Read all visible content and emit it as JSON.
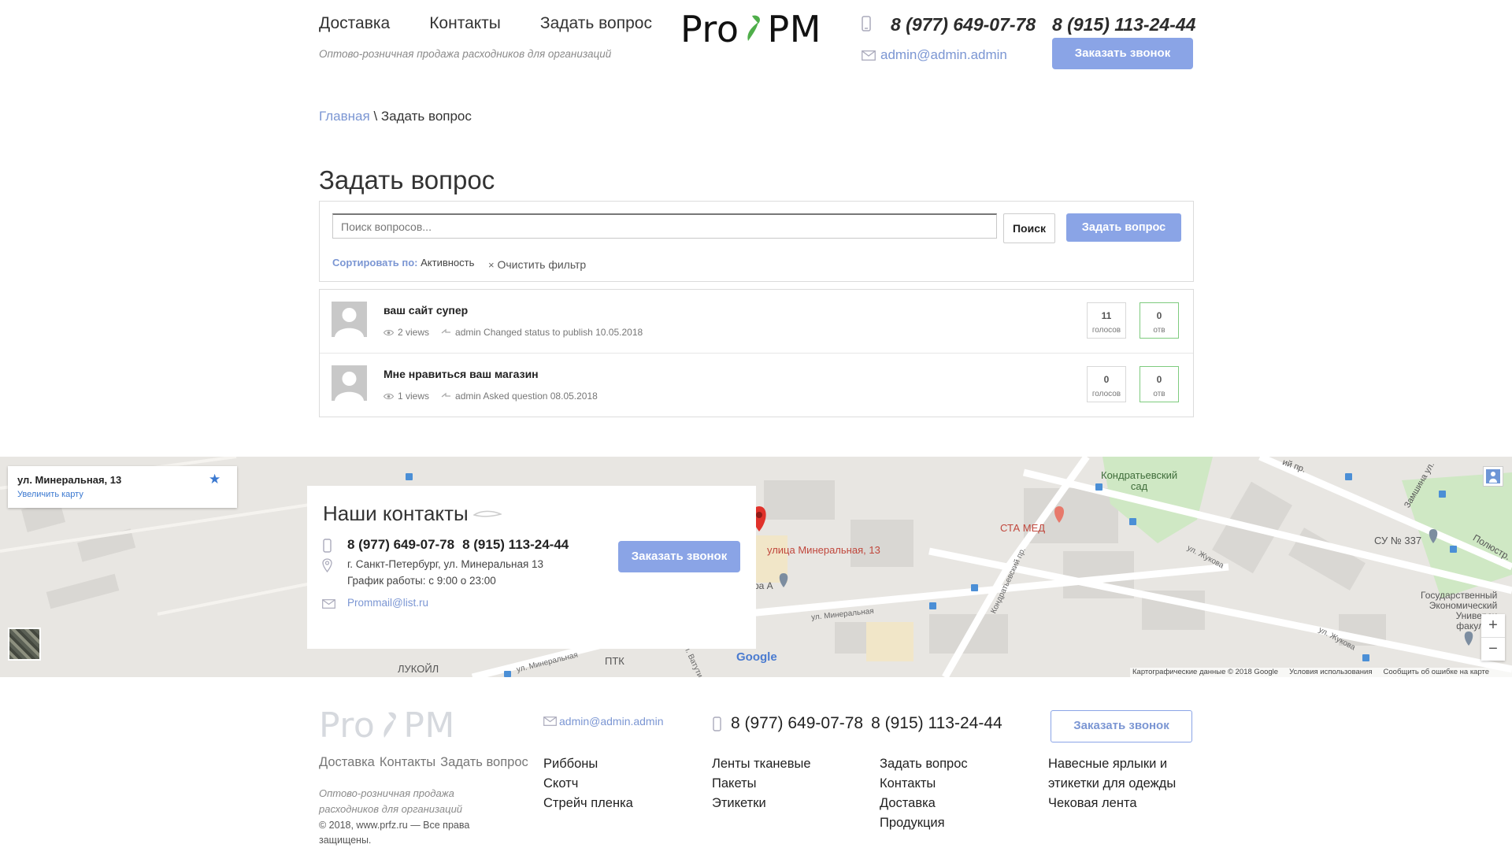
{
  "header": {
    "nav": [
      "Доставка",
      "Контакты",
      "Задать вопрос"
    ],
    "tagline": "Оптово-розничная продажа расходников для организаций",
    "logo_left": "Pro",
    "logo_right": "PM",
    "phone1": "8 (977) 649-07-78",
    "phone2": "8 (915) 113-24-44",
    "email": "admin@admin.admin",
    "call_button": "Заказать звонок"
  },
  "breadcrumb": {
    "home": "Главная",
    "sep": " \\ ",
    "current": "Задать вопрос"
  },
  "page_title": "Задать вопрос",
  "search": {
    "placeholder": "Поиск вопросов...",
    "search_button": "Поиск",
    "ask_button": "Задать вопрос",
    "sort_label": "Сортировать по:",
    "sort_value": "Активность",
    "clear_icon": "×",
    "clear_label": "Очистить фильтр"
  },
  "questions": [
    {
      "title": "ваш сайт супер",
      "views": "2 views",
      "meta": "admin Changed status to publish 10.05.2018",
      "votes": "11",
      "votes_label": "голосов",
      "answers": "0",
      "answers_label": "отв"
    },
    {
      "title": "Мне нравиться ваш магазин",
      "views": "1 views",
      "meta": "admin Asked question 08.05.2018",
      "votes": "0",
      "votes_label": "голосов",
      "answers": "0",
      "answers_label": "отв"
    }
  ],
  "map": {
    "place_title": "ул. Минеральная, 13",
    "enlarge_link": "Увеличить карту",
    "labels": {
      "garden": "Кондратьевский\nсад",
      "sta_med": "СТА МЕД",
      "pin": "улица Минеральная, 13",
      "su": "СУ № 337",
      "street_mineral": "ул. Минеральная",
      "street_mineral2": "ул. Минеральная",
      "street_zhukova": "ул. Жукова",
      "street_zhukova2": "ул. Жукова",
      "kondr": "Кондратьевский пр.",
      "poly": "Полюстр.",
      "zamsh": "Замшина ул.",
      "pr": "ий пр.",
      "econ": "Государственный\nЭкономический\nУниверси\nфакульте",
      "lukoil": "ЛУКОЙЛ",
      "ptk": "ПТК",
      "vatut": "ул. Ватути",
      "ra": "ра А",
      "google": "Google"
    },
    "attribution": [
      "Картографические данные © 2018 Google",
      "Условия использования",
      "Сообщить об ошибке на карте"
    ],
    "zoom_in": "+",
    "zoom_out": "−"
  },
  "contacts": {
    "title": "Наши контакты",
    "phone1": "8 (977) 649-07-78",
    "phone2": "8 (915) 113-24-44",
    "address": "г. Санкт-Петербург, ул. Минеральная 13",
    "hours": "График работы: с 9:00 о 23:00",
    "email": "Prommail@list.ru",
    "call_button": "Заказать звонок"
  },
  "footer": {
    "logo_left": "Pro",
    "logo_right": "PM",
    "nav": [
      "Доставка",
      "Контакты",
      "Задать вопрос"
    ],
    "tagline": "Оптово-розничная продажа расходников для организаций",
    "copyright": "© 2018, www.prfz.ru — Все права защищены.",
    "email": "admin@admin.admin",
    "phone1": "8 (977) 649-07-78",
    "phone2": "8 (915) 113-24-44",
    "call_button": "Заказать звонок",
    "col1": [
      "Риббоны",
      "Скотч",
      "Стрейч пленка"
    ],
    "col2": [
      "Ленты тканевые",
      "Пакеты",
      "Этикетки"
    ],
    "col3": [
      "Задать вопрос",
      "Контакты",
      "Доставка",
      "Продукция"
    ],
    "col4": [
      "Навесные ярлыки и этикетки для одежды",
      "Чековая лента"
    ]
  },
  "colors": {
    "accent": "#8aa4e6",
    "link": "#7b96d3",
    "green_border": "#7ecb7e",
    "pin_red": "#e0322b"
  }
}
